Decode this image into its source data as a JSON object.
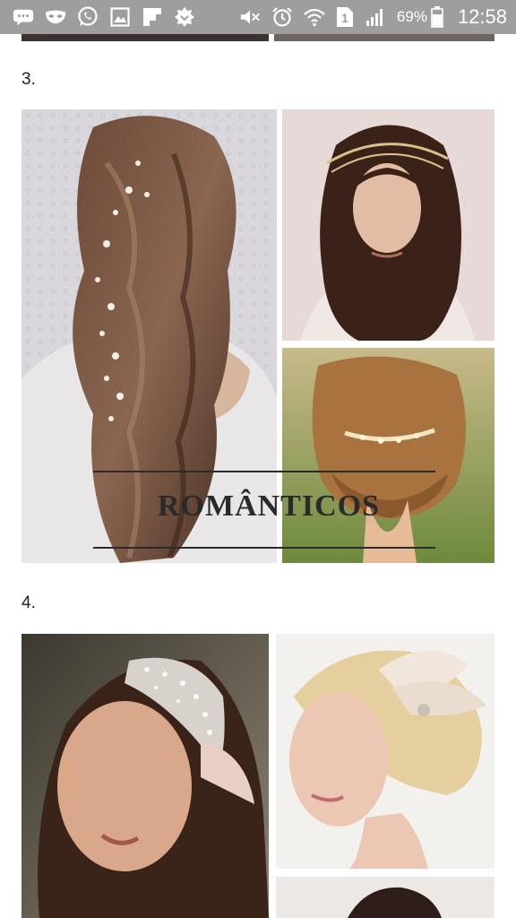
{
  "status_bar": {
    "left_icons": [
      "message-icon",
      "mask-icon",
      "whatsapp-icon",
      "gallery-icon",
      "flipboard-icon",
      "badge-icon"
    ],
    "right_icons": [
      "mute-icon",
      "alarm-icon",
      "wifi-icon",
      "sim-icon",
      "signal-icon",
      "battery-icon"
    ],
    "sim_label": "1",
    "battery_percent": "69%",
    "time": "12:58",
    "bar_color": "#9e9e9e"
  },
  "sections": [
    {
      "number": "3.",
      "banner_text": "ROMÂNTICOS",
      "images": [
        {
          "name": "long-wavy-hair-with-hair-vine-photo"
        },
        {
          "name": "curly-hair-with-gold-headband-photo"
        },
        {
          "name": "updo-with-gold-hair-comb-photo"
        }
      ]
    },
    {
      "number": "4.",
      "images": [
        {
          "name": "crystal-headpiece-photo"
        },
        {
          "name": "blonde-updo-with-feather-fascinator-photo"
        },
        {
          "name": "dark-hair-partial-photo"
        }
      ]
    }
  ]
}
